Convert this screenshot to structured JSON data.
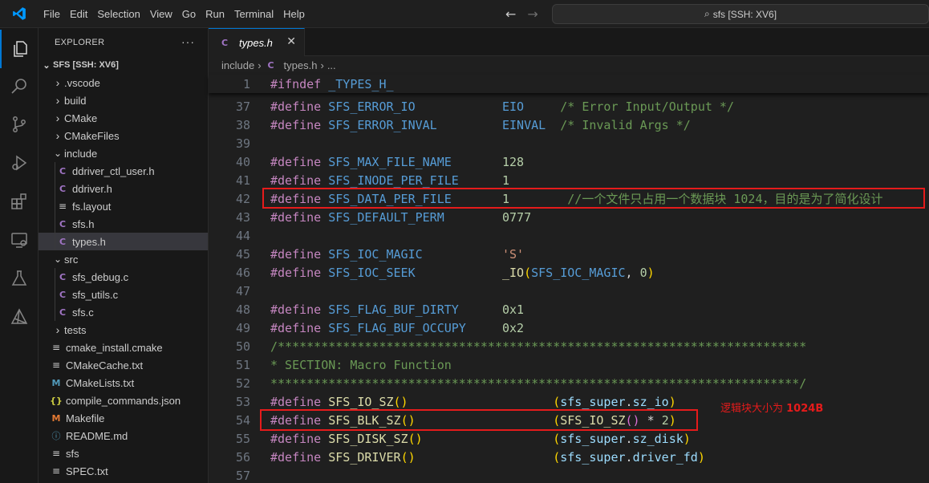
{
  "menu": [
    "File",
    "Edit",
    "Selection",
    "View",
    "Go",
    "Run",
    "Terminal",
    "Help"
  ],
  "search": {
    "text": "sfs [SSH: XV6]"
  },
  "sidebar": {
    "header": "EXPLORER",
    "root": "SFS [SSH: XV6]",
    "items": [
      {
        "label": ".vscode",
        "kind": "folder",
        "depth": 1,
        "expanded": false
      },
      {
        "label": "build",
        "kind": "folder",
        "depth": 1,
        "expanded": false
      },
      {
        "label": "CMake",
        "kind": "folder",
        "depth": 1,
        "expanded": false
      },
      {
        "label": "CMakeFiles",
        "kind": "folder",
        "depth": 1,
        "expanded": false
      },
      {
        "label": "include",
        "kind": "folder",
        "depth": 1,
        "expanded": true
      },
      {
        "label": "ddriver_ctl_user.h",
        "kind": "c",
        "depth": 2
      },
      {
        "label": "ddriver.h",
        "kind": "c",
        "depth": 2
      },
      {
        "label": "fs.layout",
        "kind": "lines",
        "depth": 2
      },
      {
        "label": "sfs.h",
        "kind": "c",
        "depth": 2
      },
      {
        "label": "types.h",
        "kind": "c",
        "depth": 2,
        "selected": true
      },
      {
        "label": "src",
        "kind": "folder",
        "depth": 1,
        "expanded": true
      },
      {
        "label": "sfs_debug.c",
        "kind": "c",
        "depth": 2
      },
      {
        "label": "sfs_utils.c",
        "kind": "c",
        "depth": 2
      },
      {
        "label": "sfs.c",
        "kind": "c",
        "depth": 2
      },
      {
        "label": "tests",
        "kind": "folder",
        "depth": 1,
        "expanded": false
      },
      {
        "label": "cmake_install.cmake",
        "kind": "lines",
        "depth": 1
      },
      {
        "label": "CMakeCache.txt",
        "kind": "lines",
        "depth": 1
      },
      {
        "label": "CMakeLists.txt",
        "kind": "m",
        "depth": 1
      },
      {
        "label": "compile_commands.json",
        "kind": "json",
        "depth": 1
      },
      {
        "label": "Makefile",
        "kind": "make",
        "depth": 1
      },
      {
        "label": "README.md",
        "kind": "info",
        "depth": 1
      },
      {
        "label": "sfs",
        "kind": "lines",
        "depth": 1
      },
      {
        "label": "SPEC.txt",
        "kind": "lines",
        "depth": 1
      }
    ]
  },
  "editor": {
    "tab_label": "types.h",
    "breadcrumb": {
      "folder": "include",
      "file": "types.h",
      "rest": "..."
    },
    "lines": [
      {
        "n": "1",
        "sticky": true,
        "tokens": [
          [
            "kw",
            "#ifndef"
          ],
          [
            "plain",
            " "
          ],
          [
            "mac",
            "_TYPES_H_"
          ]
        ]
      },
      {
        "n": "37",
        "tokens": [
          [
            "kw",
            "#define"
          ],
          [
            "plain",
            " "
          ],
          [
            "mac",
            "SFS_ERROR_IO"
          ],
          [
            "plain",
            "            "
          ],
          [
            "mac",
            "EIO"
          ],
          [
            "plain",
            "     "
          ],
          [
            "com",
            "/* Error Input/Output */"
          ]
        ]
      },
      {
        "n": "38",
        "tokens": [
          [
            "kw",
            "#define"
          ],
          [
            "plain",
            " "
          ],
          [
            "mac",
            "SFS_ERROR_INVAL"
          ],
          [
            "plain",
            "         "
          ],
          [
            "mac",
            "EINVAL"
          ],
          [
            "plain",
            "  "
          ],
          [
            "com",
            "/* Invalid Args */"
          ]
        ]
      },
      {
        "n": "39",
        "tokens": []
      },
      {
        "n": "40",
        "tokens": [
          [
            "kw",
            "#define"
          ],
          [
            "plain",
            " "
          ],
          [
            "mac",
            "SFS_MAX_FILE_NAME"
          ],
          [
            "plain",
            "       "
          ],
          [
            "num",
            "128"
          ]
        ]
      },
      {
        "n": "41",
        "tokens": [
          [
            "kw",
            "#define"
          ],
          [
            "plain",
            " "
          ],
          [
            "mac",
            "SFS_INODE_PER_FILE"
          ],
          [
            "plain",
            "      "
          ],
          [
            "num",
            "1"
          ]
        ]
      },
      {
        "n": "42",
        "tokens": [
          [
            "kw",
            "#define"
          ],
          [
            "plain",
            " "
          ],
          [
            "mac",
            "SFS_DATA_PER_FILE"
          ],
          [
            "plain",
            "       "
          ],
          [
            "num",
            "1"
          ],
          [
            "plain",
            "        "
          ],
          [
            "com",
            "//一个文件只占用一个数据块 1024，目的是为了简化设计"
          ]
        ]
      },
      {
        "n": "43",
        "tokens": [
          [
            "kw",
            "#define"
          ],
          [
            "plain",
            " "
          ],
          [
            "mac",
            "SFS_DEFAULT_PERM"
          ],
          [
            "plain",
            "        "
          ],
          [
            "num",
            "0777"
          ]
        ]
      },
      {
        "n": "44",
        "tokens": []
      },
      {
        "n": "45",
        "tokens": [
          [
            "kw",
            "#define"
          ],
          [
            "plain",
            " "
          ],
          [
            "mac",
            "SFS_IOC_MAGIC"
          ],
          [
            "plain",
            "           "
          ],
          [
            "str",
            "'S'"
          ]
        ]
      },
      {
        "n": "46",
        "tokens": [
          [
            "kw",
            "#define"
          ],
          [
            "plain",
            " "
          ],
          [
            "mac",
            "SFS_IOC_SEEK"
          ],
          [
            "plain",
            "            "
          ],
          [
            "fn",
            "_IO"
          ],
          [
            "br1",
            "("
          ],
          [
            "mac",
            "SFS_IOC_MAGIC"
          ],
          [
            "plain",
            ", "
          ],
          [
            "num",
            "0"
          ],
          [
            "br1",
            ")"
          ]
        ]
      },
      {
        "n": "47",
        "tokens": []
      },
      {
        "n": "48",
        "tokens": [
          [
            "kw",
            "#define"
          ],
          [
            "plain",
            " "
          ],
          [
            "mac",
            "SFS_FLAG_BUF_DIRTY"
          ],
          [
            "plain",
            "      "
          ],
          [
            "num",
            "0x1"
          ]
        ]
      },
      {
        "n": "49",
        "tokens": [
          [
            "kw",
            "#define"
          ],
          [
            "plain",
            " "
          ],
          [
            "mac",
            "SFS_FLAG_BUF_OCCUPY"
          ],
          [
            "plain",
            "     "
          ],
          [
            "num",
            "0x2"
          ]
        ]
      },
      {
        "n": "50",
        "tokens": [
          [
            "com",
            "/*************************************************************************"
          ]
        ]
      },
      {
        "n": "51",
        "tokens": [
          [
            "com",
            "* SECTION: Macro Function"
          ]
        ]
      },
      {
        "n": "52",
        "tokens": [
          [
            "com",
            "*************************************************************************/"
          ]
        ]
      },
      {
        "n": "53",
        "tokens": [
          [
            "kw",
            "#define"
          ],
          [
            "plain",
            " "
          ],
          [
            "fn",
            "SFS_IO_SZ"
          ],
          [
            "br1",
            "()"
          ],
          [
            "plain",
            "                    "
          ],
          [
            "br1",
            "("
          ],
          [
            "var",
            "sfs_super"
          ],
          [
            "plain",
            "."
          ],
          [
            "var",
            "sz_io"
          ],
          [
            "br1",
            ")"
          ]
        ]
      },
      {
        "n": "54",
        "tokens": [
          [
            "kw",
            "#define"
          ],
          [
            "plain",
            " "
          ],
          [
            "fn",
            "SFS_BLK_SZ"
          ],
          [
            "br1",
            "()"
          ],
          [
            "plain",
            "                   "
          ],
          [
            "br1",
            "("
          ],
          [
            "fn",
            "SFS_IO_SZ"
          ],
          [
            "br2",
            "()"
          ],
          [
            "plain",
            " * "
          ],
          [
            "num",
            "2"
          ],
          [
            "br1",
            ")"
          ]
        ]
      },
      {
        "n": "55",
        "tokens": [
          [
            "kw",
            "#define"
          ],
          [
            "plain",
            " "
          ],
          [
            "fn",
            "SFS_DISK_SZ"
          ],
          [
            "br1",
            "()"
          ],
          [
            "plain",
            "                  "
          ],
          [
            "br1",
            "("
          ],
          [
            "var",
            "sfs_super"
          ],
          [
            "plain",
            "."
          ],
          [
            "var",
            "sz_disk"
          ],
          [
            "br1",
            ")"
          ]
        ]
      },
      {
        "n": "56",
        "tokens": [
          [
            "kw",
            "#define"
          ],
          [
            "plain",
            " "
          ],
          [
            "fn",
            "SFS_DRIVER"
          ],
          [
            "br1",
            "()"
          ],
          [
            "plain",
            "                   "
          ],
          [
            "br1",
            "("
          ],
          [
            "var",
            "sfs_super"
          ],
          [
            "plain",
            "."
          ],
          [
            "var",
            "driver_fd"
          ],
          [
            "br1",
            ")"
          ]
        ]
      },
      {
        "n": "57",
        "tokens": []
      }
    ]
  },
  "annotation": {
    "text": "逻辑块大小为 ",
    "bold": "1024B"
  },
  "colors": {
    "accent": "#0078d4",
    "highlight": "#e51b1b"
  }
}
